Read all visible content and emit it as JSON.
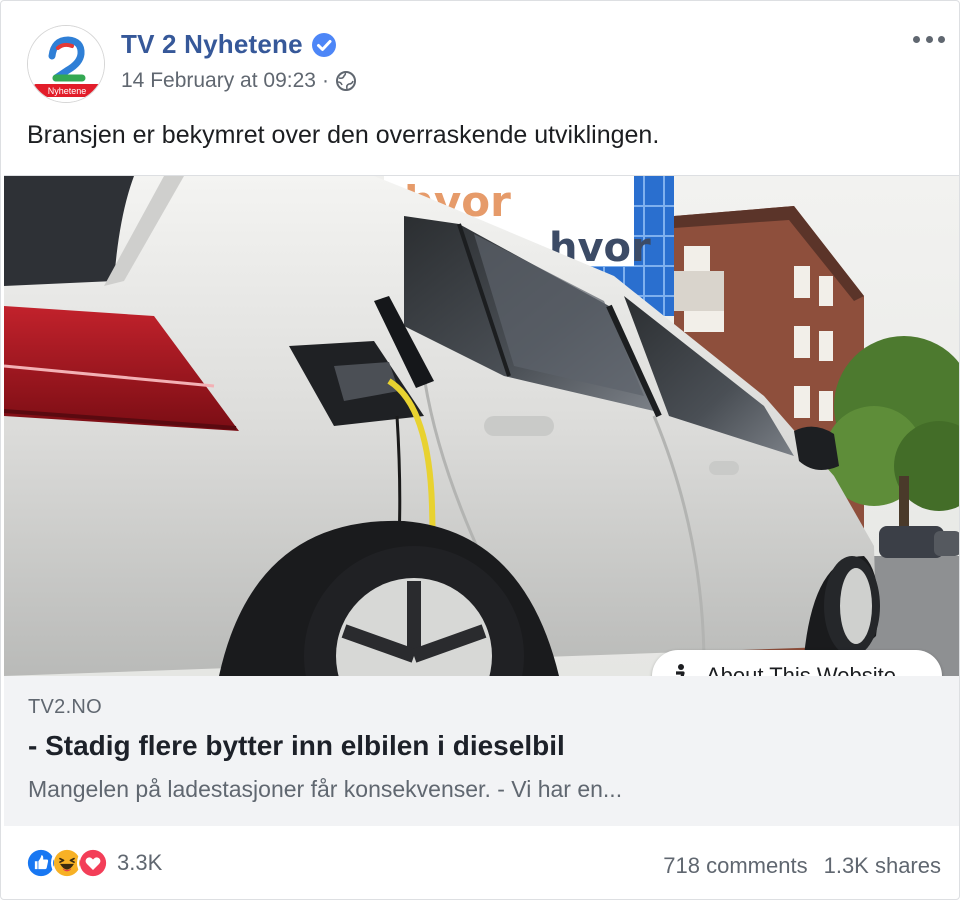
{
  "post": {
    "page_name": "TV 2 Nyhetene",
    "avatar_label": "Nyhetene",
    "timestamp": "14 February at 09:23",
    "separator": "·",
    "privacy_icon": "globe-icon",
    "verified_icon": "verified-badge-icon",
    "text": "Bransjen er bekymret over den overraskende utviklingen."
  },
  "link": {
    "about_label": "About This Website",
    "domain": "TV2.NO",
    "title": "- Stadig flere bytter inn elbilen i dieselbil",
    "description": "Mangelen på ladestasjoner får konsekvenser. - Vi har en..."
  },
  "footer": {
    "reactions": [
      "like-icon",
      "haha-icon",
      "love-icon"
    ],
    "reaction_count": "3.3K",
    "comments": "718 comments",
    "shares": "1.3K shares"
  },
  "colors": {
    "page_name": "#365899",
    "secondary_text": "#606770",
    "link_bg": "#f2f3f5",
    "like": "#1877f2",
    "haha": "#f7b125",
    "love": "#f33e58",
    "cable": "#e8d230"
  }
}
